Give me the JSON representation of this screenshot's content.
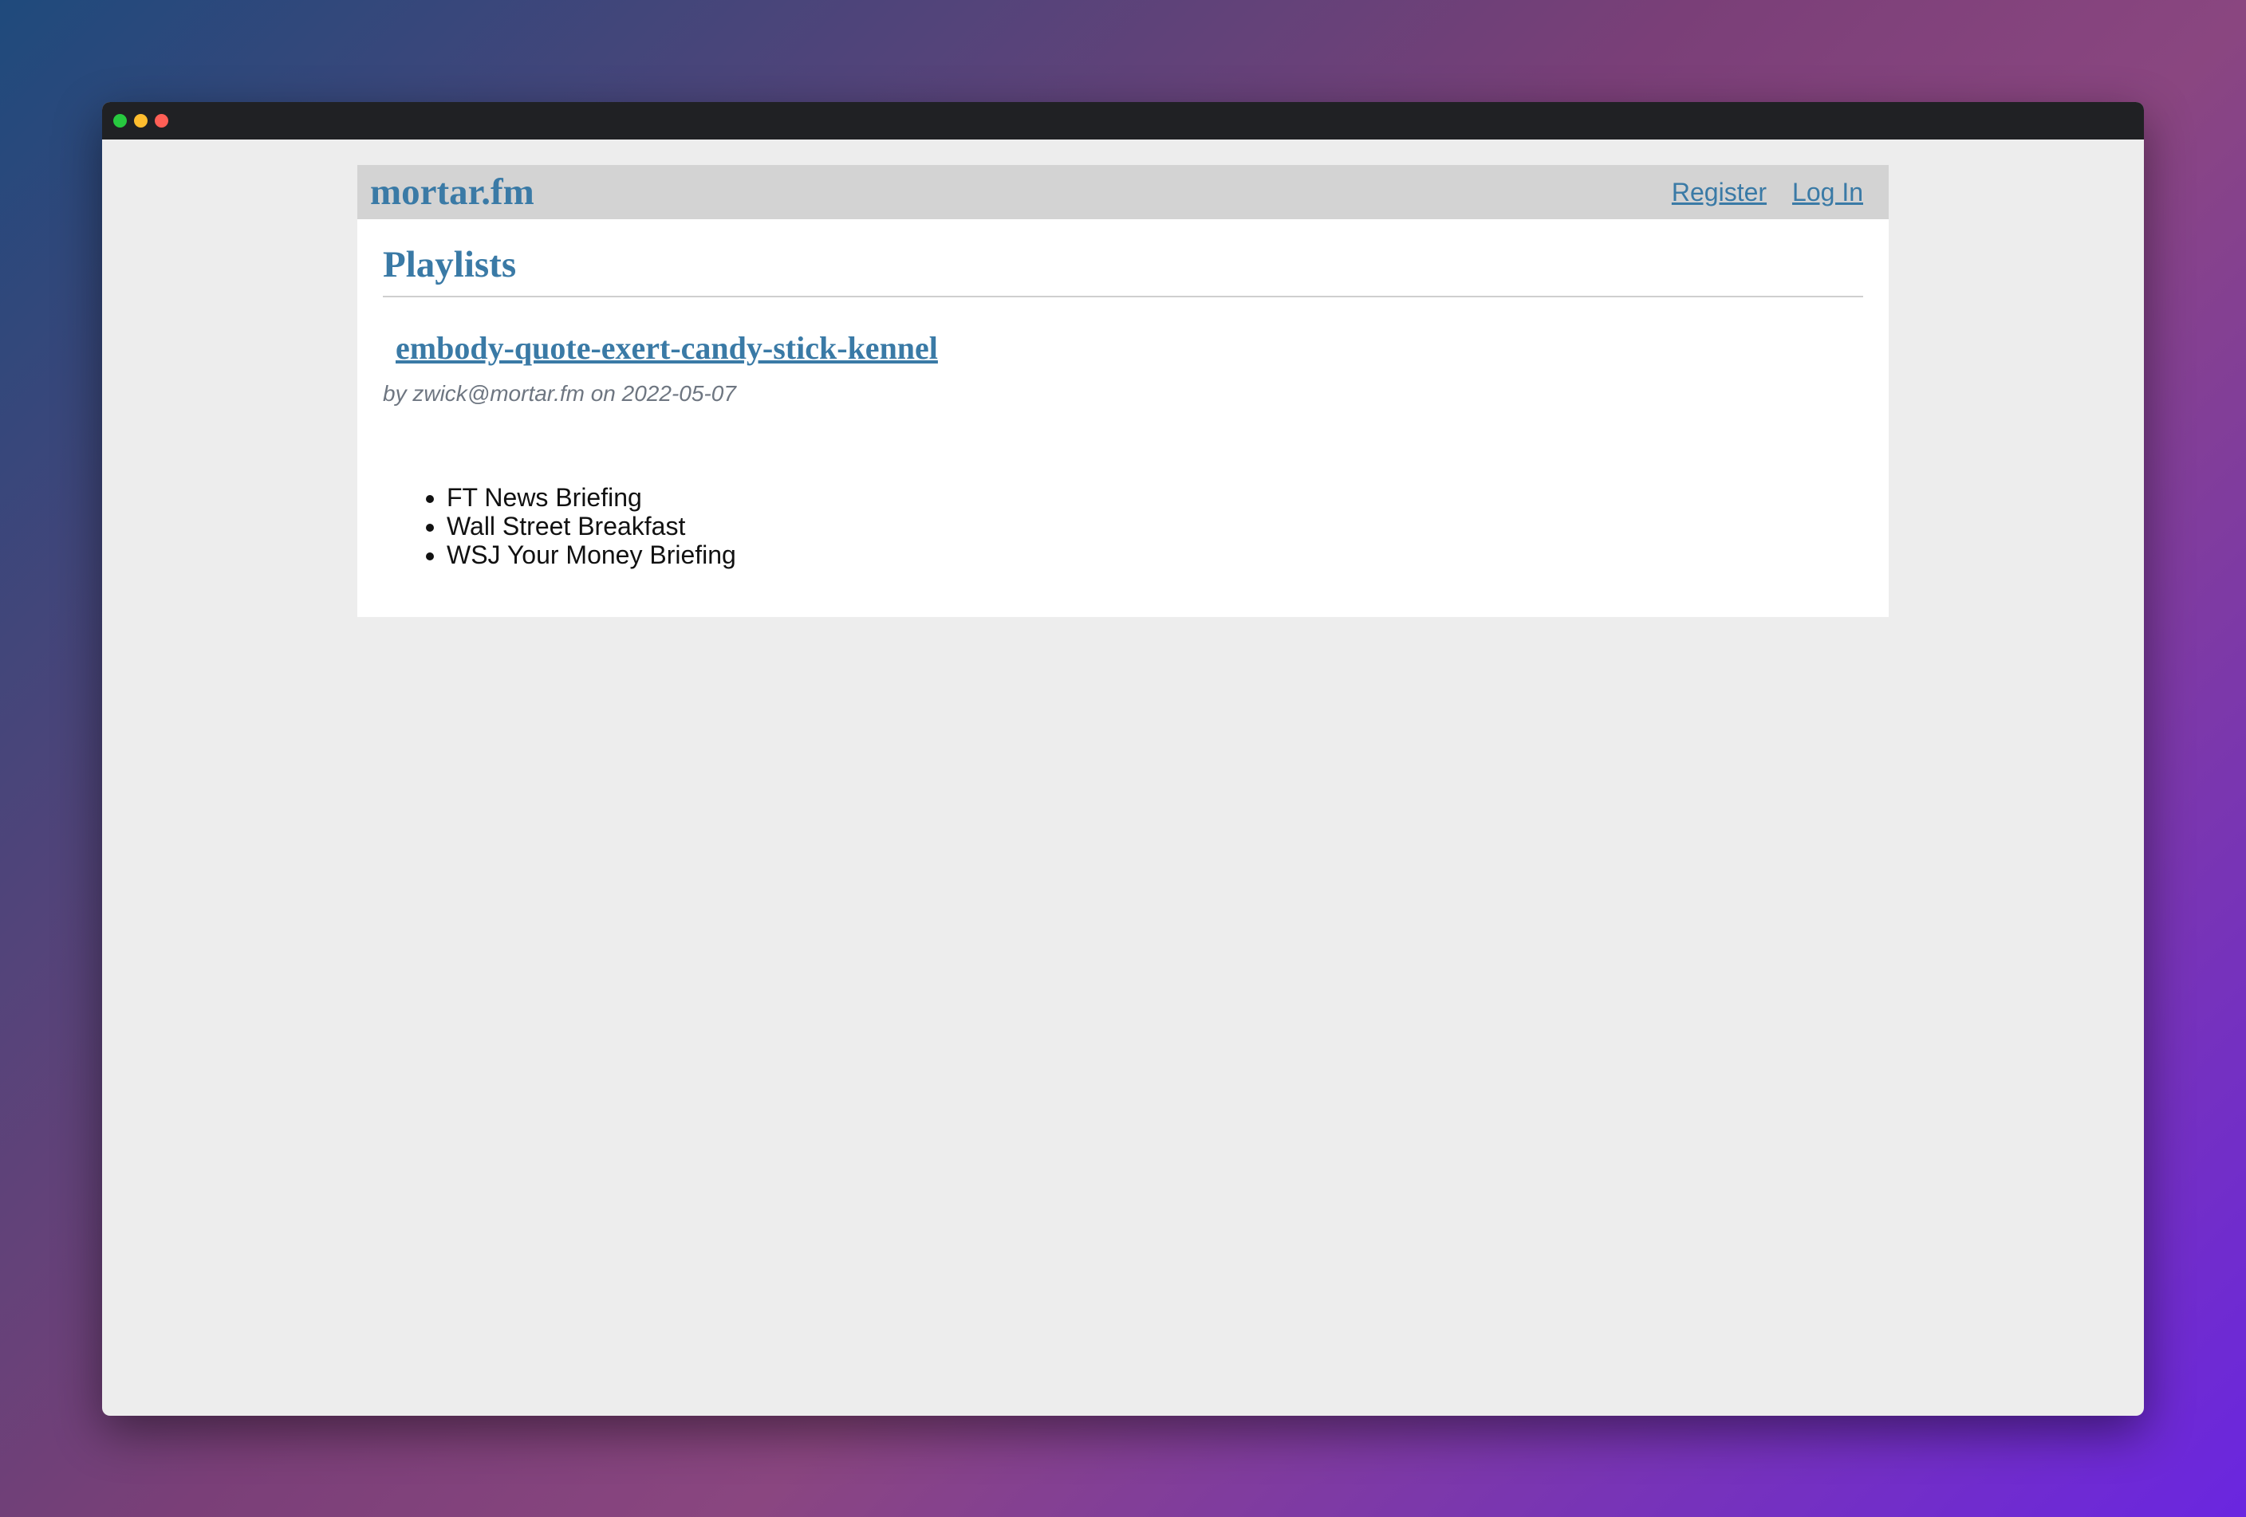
{
  "window": {
    "controls": [
      "green",
      "yellow",
      "red"
    ]
  },
  "header": {
    "brand": "mortar.fm",
    "nav": [
      {
        "label": "Register"
      },
      {
        "label": "Log In"
      }
    ]
  },
  "main": {
    "title": "Playlists",
    "playlist": {
      "name": "embody-quote-exert-candy-stick-kennel",
      "meta": "by zwick@mortar.fm on 2022-05-07",
      "items": [
        "FT News Briefing",
        "Wall Street Breakfast",
        "WSJ Your Money Briefing"
      ]
    }
  },
  "colors": {
    "accent": "#3a7aa6",
    "header_bg": "#d3d3d3",
    "titlebar": "#202124"
  }
}
